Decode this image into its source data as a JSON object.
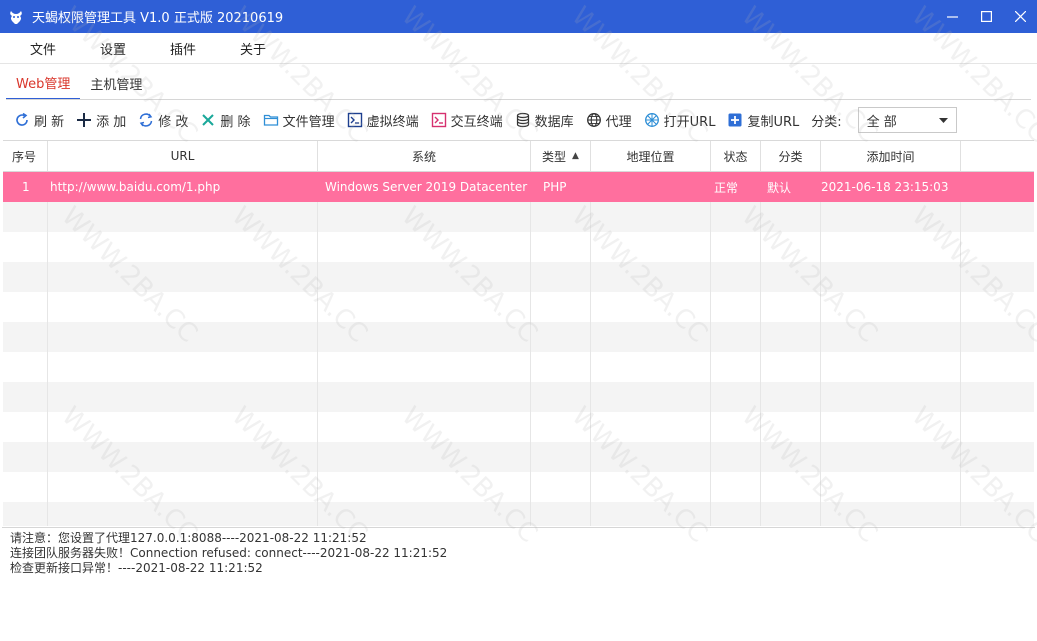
{
  "window": {
    "title": "天蝎权限管理工具 V1.0 正式版 20210619",
    "controls": [
      "minimize",
      "maximize",
      "close"
    ]
  },
  "menu": [
    "文件",
    "设置",
    "插件",
    "关于"
  ],
  "tabs": [
    {
      "label": "Web管理",
      "active": true
    },
    {
      "label": "主机管理",
      "active": false
    }
  ],
  "toolbar": {
    "buttons": [
      {
        "label": "刷 新",
        "icon": "refresh-icon"
      },
      {
        "label": "添 加",
        "icon": "plus-icon"
      },
      {
        "label": "修 改",
        "icon": "sync-icon"
      },
      {
        "label": "删 除",
        "icon": "x-icon"
      },
      {
        "label": "文件管理",
        "icon": "folder-icon"
      },
      {
        "label": "虚拟终端",
        "icon": "terminal-icon"
      },
      {
        "label": "交互终端",
        "icon": "terminal-pink-icon"
      },
      {
        "label": "数据库",
        "icon": "database-icon"
      },
      {
        "label": "代理",
        "icon": "globe-icon"
      },
      {
        "label": "打开URL",
        "icon": "network-icon"
      },
      {
        "label": "复制URL",
        "icon": "copy-plus-icon"
      }
    ],
    "filter_label": "分类:",
    "filter_value": "全 部"
  },
  "table": {
    "columns": [
      "序号",
      "URL",
      "系统",
      "类型",
      "地理位置",
      "状态",
      "分类",
      "添加时间"
    ],
    "sorted_column": "类型",
    "rows": [
      {
        "id": "1",
        "url": "http://www.baidu.com/1.php",
        "os": "Windows Server 2019 Datacenter",
        "type": "PHP",
        "location": "",
        "status": "正常",
        "category": "默认",
        "added": "2021-06-18 23:15:03"
      }
    ],
    "empty_rows": 11
  },
  "log": [
    "请注意：您设置了代理127.0.0.1:8088----2021-08-22 11:21:52",
    "连接团队服务器失败！Connection refused: connect----2021-08-22 11:21:52",
    "检查更新接口异常！----2021-08-22 11:21:52"
  ],
  "watermark": "WWW.2BA.CC",
  "colors": {
    "titlebar": "#2f5fd6",
    "selected_row": "#ff6f9e",
    "active_tab_text": "#d9362b"
  }
}
